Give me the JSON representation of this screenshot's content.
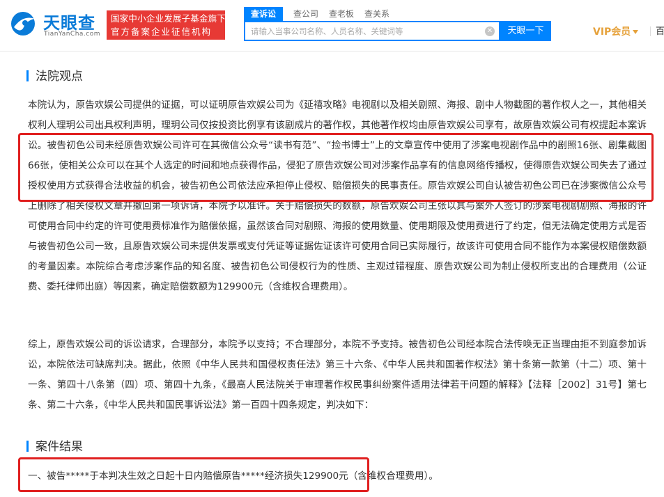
{
  "header": {
    "logo_name": "天眼查",
    "logo_domain": "TianYanCha.com",
    "badge_line1": "国家中小企业发展子基金旗下",
    "badge_line2": "官方备案企业征信机构",
    "search_tabs": [
      "查诉讼",
      "查公司",
      "查老板",
      "查关系"
    ],
    "search_placeholder": "请输入当事公司名称、人员名称、关键词等",
    "search_button": "天眼一下",
    "vip_label": "VIP会员",
    "nav_more": "百",
    "colors": {
      "brand_blue": "#0084ff",
      "badge_red": "#e73935",
      "vip_gold": "#e6a23c",
      "highlight_red": "#e02020"
    }
  },
  "sections": {
    "court_opinion_title": "法院观点",
    "court_opinion_p1": "本院认为，原告欢娱公司提供的证据，可以证明原告欢娱公司为《延禧攻略》电视剧以及相关剧照、海报、剧中人物截图的著作权人之一，其他相关权利人理玥公司出具权利声明，理玥公司仅按投资比例享有该剧成片的著作权，其他著作权均由原告欢娱公司享有，故原告欢娱公司有权提起本案诉讼。被告初色公司未经原告欢娱公司许可在其微信公众号“读书有范”、“捡书博士”上的文章宣传中使用了涉案电视剧作品中的剧照16张、剧集截图66张，使相关公众可以在其个人选定的时间和地点获得作品，侵犯了原告欢娱公司对涉案作品享有的信息网络传播权，使得原告欢娱公司失去了通过授权使用方式获得合法收益的机会，被告初色公司依法应承担停止侵权、赔偿损失的民事责任。原告欢娱公司自认被告初色公司已在涉案微信公众号上删除了相关侵权文章并撤回第一项诉请，本院予以准许。关于赔偿损失的数额，原告欢娱公司主张以其与案外人签订的涉案电视剧剧照、海报的许可使用合同中约定的许可使用费标准作为赔偿依据，虽然该合同对剧照、海报的使用数量、使用期限及使用费进行了约定，但无法确定使用方式是否与被告初色公司一致，且原告欢娱公司未提供发票或支付凭证等证据佐证该许可使用合同已实际履行，故该许可使用合同不能作为本案侵权赔偿数额的考量因素。本院综合考虑涉案作品的知名度、被告初色公司侵权行为的性质、主观过错程度、原告欢娱公司为制止侵权所支出的合理费用（公证费、委托律师出庭）等因素，确定赔偿数额为129900元（含维权合理费用）。",
    "court_opinion_p2": "综上，原告欢娱公司的诉讼请求，合理部分，本院予以支持；不合理部分，本院不予支持。被告初色公司经本院合法传唤无正当理由拒不到庭参加诉讼，本院依法可缺席判决。据此，依照《中华人民共和国侵权责任法》第三十六条、《中华人民共和国著作权法》第十条第一款第（十二）项、第十一条、第四十八条第（四）项、第四十九条，《最高人民法院关于审理著作权民事纠纷案件适用法律若干问题的解释》【法释［2002］31号】第七条、第二十六条，《中华人民共和国民事诉讼法》第一百四十四条规定，判决如下：",
    "result_title": "案件结果",
    "result_p1": "一、被告*****于本判决生效之日起十日内赔偿原告*****经济损失129900元（含维权合理费用）。"
  }
}
